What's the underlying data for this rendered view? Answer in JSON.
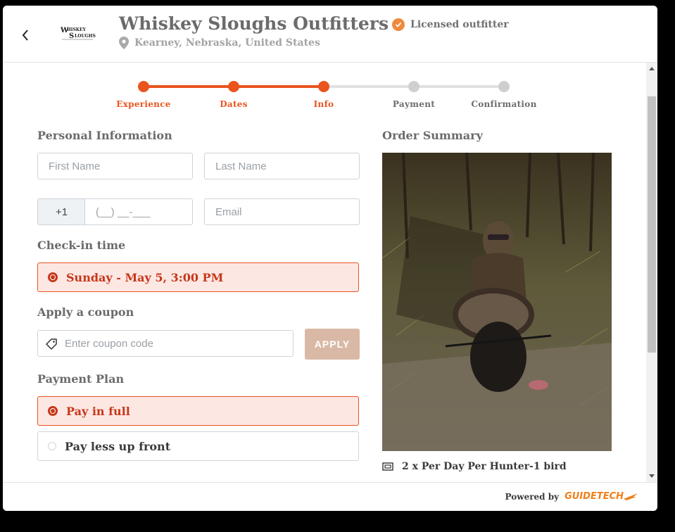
{
  "header": {
    "back_icon": "chevron-left-icon",
    "logo_text": "WHISKEY SLOUGHS",
    "title": "Whiskey Sloughs Outfitters",
    "location": "Kearney, Nebraska, United States",
    "licensed_label": "Licensed outfitter"
  },
  "steps": [
    {
      "label": "Experience",
      "done": true
    },
    {
      "label": "Dates",
      "done": true
    },
    {
      "label": "Info",
      "done": true
    },
    {
      "label": "Payment",
      "done": false
    },
    {
      "label": "Confirmation",
      "done": false
    }
  ],
  "personal": {
    "title": "Personal Information",
    "first_name_placeholder": "First Name",
    "last_name_placeholder": "Last Name",
    "phone_prefix": "+1",
    "phone_placeholder": "(__) __-___",
    "email_placeholder": "Email"
  },
  "checkin": {
    "title": "Check-in time",
    "selected": "Sunday - May 5, 3:00 PM"
  },
  "coupon": {
    "title": "Apply a coupon",
    "placeholder": "Enter coupon code",
    "apply_label": "APPLY"
  },
  "payment_plan": {
    "title": "Payment Plan",
    "options": [
      {
        "label": "Pay in full",
        "selected": true
      },
      {
        "label": "Pay less up front",
        "selected": false
      }
    ]
  },
  "order": {
    "title": "Order Summary",
    "line_item": "2 x Per Day Per Hunter-1 bird"
  },
  "footer": {
    "powered_by": "Powered by",
    "brand": "GUIDETECH"
  },
  "colors": {
    "accent": "#e9541f",
    "selected_bg": "#fde7e3",
    "apply_disabled": "#d9b9a6",
    "licensed_badge": "#ee8a3c"
  }
}
